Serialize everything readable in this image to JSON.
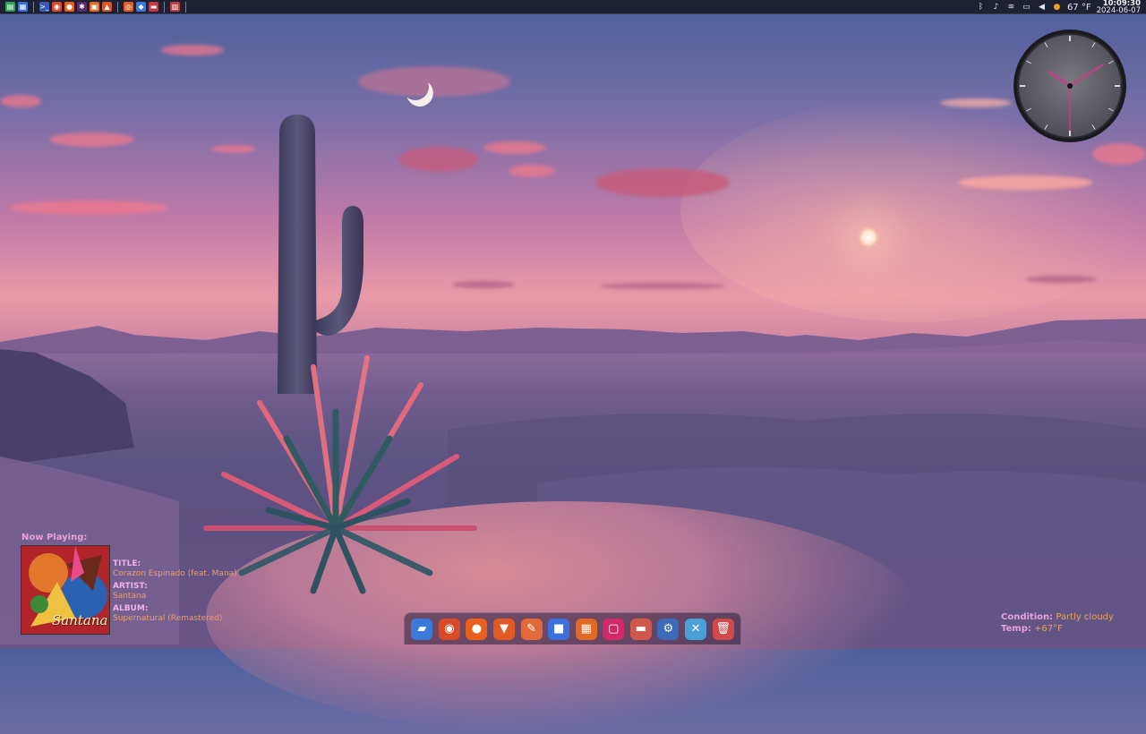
{
  "panel": {
    "launchers": [
      {
        "name": "file-manager-icon",
        "color": "#2fa35a",
        "glyph": "▤"
      },
      {
        "name": "files-icon",
        "color": "#3a6fd8",
        "glyph": "▦"
      },
      {
        "name": "terminal-icon",
        "color": "#3b5bb0",
        "glyph": ">_"
      },
      {
        "name": "chrome-icon",
        "color": "#d84a2a",
        "glyph": "◉"
      },
      {
        "name": "firefox-icon",
        "color": "#e8601c",
        "glyph": "●"
      },
      {
        "name": "slack-icon",
        "color": "#5a2a6a",
        "glyph": "✱"
      },
      {
        "name": "calculator-icon",
        "color": "#e07020",
        "glyph": "▣"
      },
      {
        "name": "fire-app-icon",
        "color": "#d8542a",
        "glyph": "▲"
      },
      {
        "name": "browser-icon",
        "color": "#e25c24",
        "glyph": "◎"
      },
      {
        "name": "shield-icon",
        "color": "#3a7ad8",
        "glyph": "◆"
      },
      {
        "name": "drive-icon",
        "color": "#c0384a",
        "glyph": "▬"
      },
      {
        "name": "trash-icon",
        "color": "#c04040",
        "glyph": "▥"
      }
    ],
    "tray": {
      "weather_temp": "67 °F",
      "time": "10:09:30",
      "date": "2024-06-07"
    }
  },
  "now_playing": {
    "heading": "Now Playing:",
    "title_label": "TITLE:",
    "title": "Corazon Espinado (feat. Mana)",
    "artist_label": "ARTIST:",
    "artist": "Santana",
    "album_label": "ALBUM:",
    "album": "Supernatural (Remastered)",
    "art_text": "Santana"
  },
  "weather_widget": {
    "condition_label": "Condition:",
    "condition": "Partly cloudy",
    "temp_label": "Temp:",
    "temp": "+67°F"
  },
  "dock": {
    "items": [
      {
        "name": "files-dock-icon",
        "color": "#3a7ad8",
        "glyph": "▰"
      },
      {
        "name": "chrome-dock-icon",
        "color": "#d84a2a",
        "glyph": "◉"
      },
      {
        "name": "firefox-dock-icon",
        "color": "#e8601c",
        "glyph": "●"
      },
      {
        "name": "brave-dock-icon",
        "color": "#e05a24",
        "glyph": "▼"
      },
      {
        "name": "editor-dock-icon",
        "color": "#e06a3a",
        "glyph": "✎"
      },
      {
        "name": "video-dock-icon",
        "color": "#3a70e0",
        "glyph": "■"
      },
      {
        "name": "calculator-dock-icon",
        "color": "#e06a24",
        "glyph": "▦"
      },
      {
        "name": "screenshot-dock-icon",
        "color": "#d02a6a",
        "glyph": "▢"
      },
      {
        "name": "drive-dock-icon",
        "color": "#d0584a",
        "glyph": "▬"
      },
      {
        "name": "settings-dock-icon",
        "color": "#3a6ab8",
        "glyph": "⚙"
      },
      {
        "name": "network-dock-icon",
        "color": "#4aa0d8",
        "glyph": "✕"
      },
      {
        "name": "trash-dock-icon",
        "color": "#d04a4a",
        "glyph": "🗑"
      }
    ]
  },
  "clock_widget": {
    "hour": 10,
    "minute": 9,
    "second": 30
  }
}
